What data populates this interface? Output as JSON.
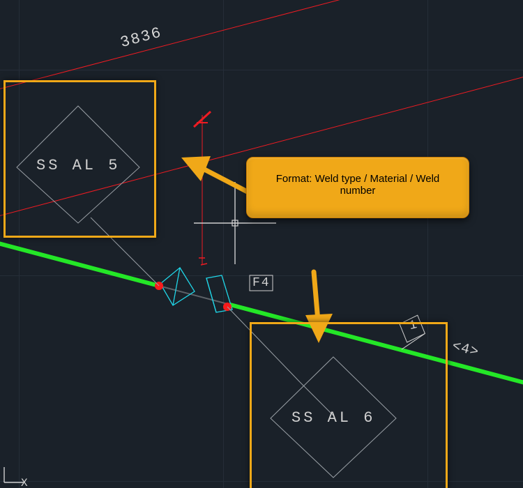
{
  "dimension": {
    "value": "3836"
  },
  "weld_labels": {
    "top": "SS AL 5",
    "bottom": "SS AL 6"
  },
  "tags": {
    "f4": "F4",
    "flag1": "1",
    "angle4": "<4>"
  },
  "callout": {
    "text_line1": "Format: Weld type / Material / Weld",
    "text_line2": "number"
  },
  "ucs_label": "X",
  "colors": {
    "bg": "#1a2129",
    "grid": "#252d38",
    "red": "#ee1b22",
    "green": "#24e727",
    "cyan": "#20d6e8",
    "white": "#d0d0d0",
    "orange": "#f0a818",
    "dot_red": "#f71b1b"
  }
}
